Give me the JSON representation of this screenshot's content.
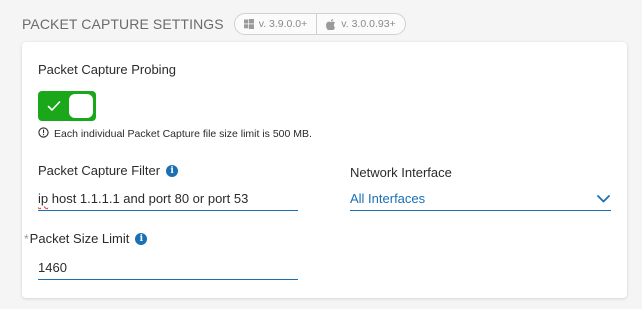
{
  "header": {
    "title": "PACKET CAPTURE SETTINGS",
    "versions": [
      {
        "os_icon": "windows-icon",
        "label": "v. 3.9.0.0+"
      },
      {
        "os_icon": "apple-icon",
        "label": "v. 3.0.0.93+"
      }
    ]
  },
  "probing": {
    "label": "Packet Capture Probing",
    "enabled": true,
    "note": "Each individual Packet Capture file size limit is 500 MB."
  },
  "filter": {
    "label": "Packet Capture Filter",
    "value_prefix": "ip",
    "value_rest": " host 1.1.1.1 and port 80 or port 53"
  },
  "network_interface": {
    "label": "Network Interface",
    "selected": "All Interfaces"
  },
  "packet_size": {
    "required_mark": "*",
    "label": "Packet Size Limit",
    "value": "1460"
  },
  "colors": {
    "accent": "#1b6fb3",
    "toggle_on": "#1aa71a"
  }
}
